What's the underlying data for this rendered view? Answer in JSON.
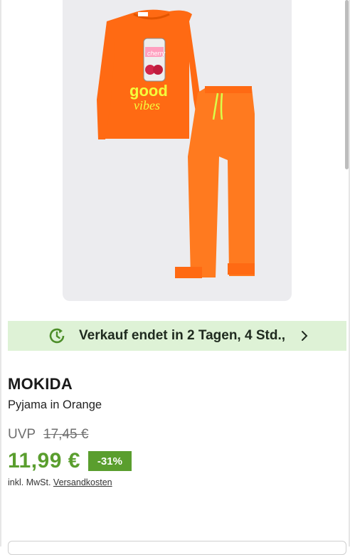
{
  "product_image": {
    "alt": "Orange pyjama",
    "shirt_print_top": "good",
    "shirt_print_bottom": "vibes",
    "can_label": "cherry"
  },
  "sale_banner": {
    "text": "Verkauf endet in 2 Tagen, 4 Std.,",
    "icon": "clock-arrow-icon",
    "chevron": "chevron-right-icon"
  },
  "product": {
    "brand": "MOKIDA",
    "name": "Pyjama in Orange"
  },
  "pricing": {
    "uvp_label": "UVP",
    "uvp_price": "17,45 €",
    "price": "11,99 €",
    "discount": "-31%",
    "tax_text": "inkl. MwSt.",
    "shipping_link": "Versandkosten"
  },
  "colors": {
    "accent_green": "#5a9e2e",
    "banner_bg": "#def2d6",
    "shirt_orange": "#ff6a13",
    "pants_orange": "#ff7a1f"
  }
}
